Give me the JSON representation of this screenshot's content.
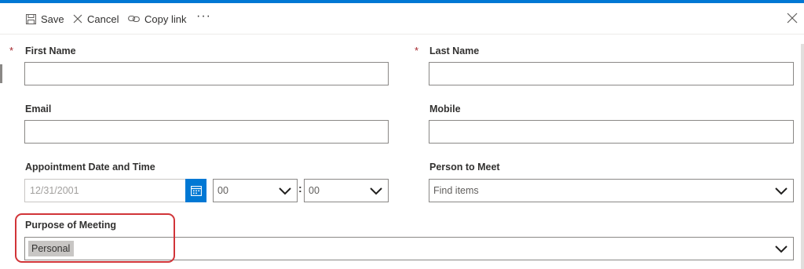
{
  "toolbar": {
    "save_label": "Save",
    "cancel_label": "Cancel",
    "copy_link_label": "Copy link",
    "more_label": "···",
    "save_icon": "save-icon",
    "cancel_icon": "cancel-icon",
    "copy_link_icon": "link-icon",
    "close_icon": "close-icon"
  },
  "form": {
    "required_marker": "*",
    "first_name": {
      "label": "First Name",
      "value": "",
      "required": true
    },
    "last_name": {
      "label": "Last Name",
      "value": "",
      "required": true
    },
    "email": {
      "label": "Email",
      "value": ""
    },
    "mobile": {
      "label": "Mobile",
      "value": ""
    },
    "appointment": {
      "label": "Appointment Date and Time",
      "date_value": "12/31/2001",
      "hour_value": "00",
      "minute_value": "00",
      "separator": ":",
      "calendar_icon": "calendar-icon"
    },
    "person_to_meet": {
      "label": "Person to Meet",
      "placeholder": "Find items"
    },
    "purpose": {
      "label": "Purpose of Meeting",
      "selected_tag": "Personal"
    }
  },
  "colors": {
    "accent": "#0078d4",
    "highlight": "#d13438",
    "required": "#a4262c"
  }
}
